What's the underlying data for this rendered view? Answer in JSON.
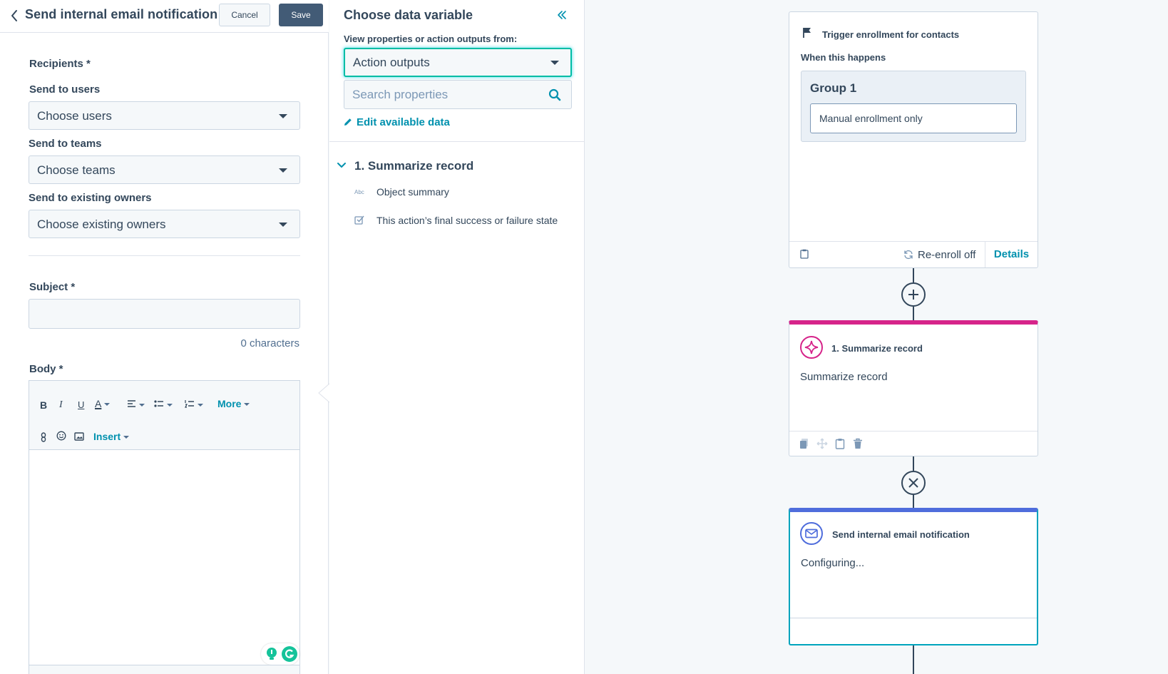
{
  "header": {
    "title": "Send internal email notification",
    "cancel_label": "Cancel",
    "save_label": "Save"
  },
  "form": {
    "recipients_label": "Recipients *",
    "send_to_users_label": "Send to users",
    "users_value": "Choose users",
    "send_to_teams_label": "Send to teams",
    "teams_value": "Choose teams",
    "send_to_owners_label": "Send to existing owners",
    "owners_value": "Choose existing owners",
    "subject_label": "Subject *",
    "subject_value": "",
    "char_count": "0 characters",
    "body_label": "Body *",
    "toolbar": {
      "bold": "B",
      "italic": "I",
      "underline": "U",
      "text_color": "A",
      "more_label": "More",
      "insert_label": "Insert"
    }
  },
  "variable_panel": {
    "title": "Choose data variable",
    "source_label": "View properties or action outputs from:",
    "source_value": "Action outputs",
    "search_placeholder": "Search properties",
    "edit_data_label": "Edit available data",
    "section_title": "1. Summarize record",
    "items": [
      {
        "icon": "Abc",
        "label": "Object summary"
      },
      {
        "icon": "status-check-icon",
        "label": "This action’s final success or failure state"
      }
    ]
  },
  "workflow": {
    "trigger": {
      "title": "Trigger enrollment for contacts",
      "when_label": "When this happens",
      "group_title": "Group 1",
      "filter_text": "Manual enrollment only",
      "reenroll_label": "Re-enroll off",
      "details_label": "Details"
    },
    "summarize_action": {
      "name": "1. Summarize record",
      "description": "Summarize record",
      "accent": "#d6248a"
    },
    "email_action": {
      "name": "Send internal email notification",
      "description": "Configuring...",
      "accent": "#4f6ddc"
    }
  },
  "colors": {
    "link": "#0091ae",
    "save_button": "#425b76",
    "text": "#33475b"
  }
}
